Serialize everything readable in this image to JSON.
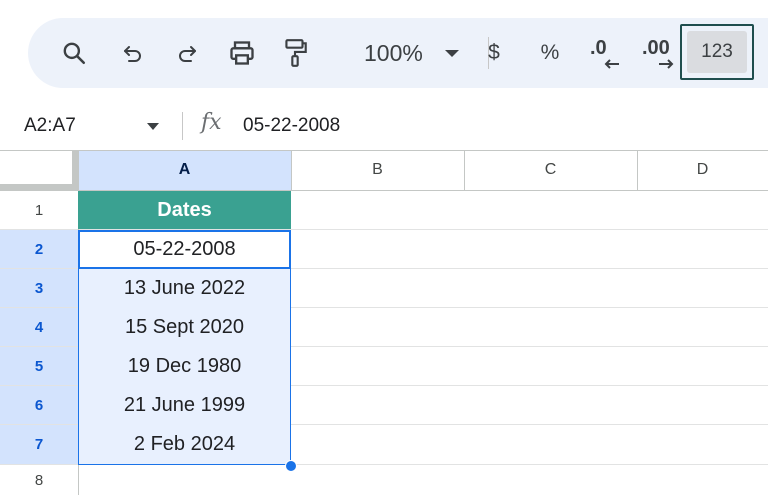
{
  "toolbar": {
    "zoom": "100%",
    "currency_symbol": "$",
    "percent_symbol": "%",
    "decrease_decimal": ".0",
    "increase_decimal": ".00",
    "more_formats": "123",
    "icons": [
      "search-icon",
      "undo-icon",
      "redo-icon",
      "print-icon",
      "paint-format-icon",
      "chevron-down-icon"
    ]
  },
  "formula_bar": {
    "name_box": "A2:A7",
    "fx_label": "fx",
    "content": "05-22-2008"
  },
  "grid": {
    "columns": [
      "A",
      "B",
      "C",
      "D"
    ],
    "rows": [
      "1",
      "2",
      "3",
      "4",
      "5",
      "6",
      "7",
      "8"
    ],
    "header_cell": "Dates",
    "dates": [
      "05-22-2008",
      "13 June 2022",
      "15 Sept 2020",
      "19 Dec 1980",
      "21 June 1999",
      "2 Feb 2024"
    ],
    "colors": {
      "header_fill": "#3aa191",
      "selection_fill": "#e8f0fe",
      "selection_border": "#1a73e8",
      "selected_header_fill": "#d3e3fd"
    }
  }
}
